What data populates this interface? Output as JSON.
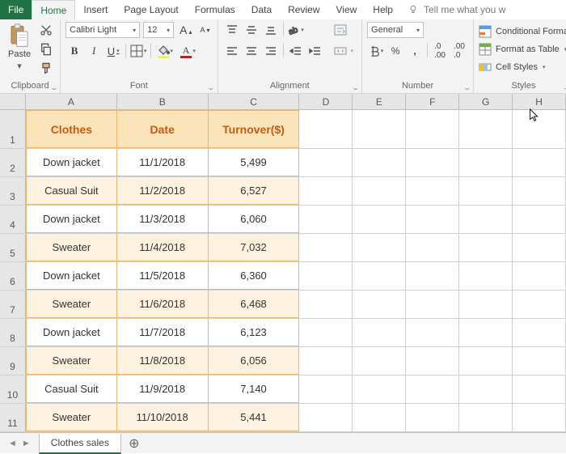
{
  "menu": {
    "file": "File",
    "home": "Home",
    "insert": "Insert",
    "page_layout": "Page Layout",
    "formulas": "Formulas",
    "data": "Data",
    "review": "Review",
    "view": "View",
    "help": "Help",
    "tell_me": "Tell me what you w"
  },
  "ribbon": {
    "clipboard": {
      "label": "Clipboard",
      "paste": "Paste"
    },
    "font": {
      "label": "Font",
      "name": "Calibri Light",
      "size": "12",
      "bold": "B",
      "italic": "I",
      "underline": "U"
    },
    "alignment": {
      "label": "Alignment"
    },
    "number": {
      "label": "Number",
      "format": "General",
      "percent": "%",
      "comma": ","
    },
    "styles": {
      "label": "Styles",
      "conditional": "Conditional Forma",
      "table": "Format as Table",
      "cell": "Cell Styles"
    }
  },
  "columns": [
    "A",
    "B",
    "C",
    "D",
    "E",
    "F",
    "G",
    "H"
  ],
  "table": {
    "headers": [
      "Clothes",
      "Date",
      "Turnover($)"
    ],
    "rows": [
      {
        "n": "2",
        "c": "Down jacket",
        "d": "11/1/2018",
        "t": "5,499",
        "band": false
      },
      {
        "n": "3",
        "c": "Casual Suit",
        "d": "11/2/2018",
        "t": "6,527",
        "band": true
      },
      {
        "n": "4",
        "c": "Down jacket",
        "d": "11/3/2018",
        "t": "6,060",
        "band": false
      },
      {
        "n": "5",
        "c": "Sweater",
        "d": "11/4/2018",
        "t": "7,032",
        "band": true
      },
      {
        "n": "6",
        "c": "Down jacket",
        "d": "11/5/2018",
        "t": "6,360",
        "band": false
      },
      {
        "n": "7",
        "c": "Sweater",
        "d": "11/6/2018",
        "t": "6,468",
        "band": true
      },
      {
        "n": "8",
        "c": "Down jacket",
        "d": "11/7/2018",
        "t": "6,123",
        "band": false
      },
      {
        "n": "9",
        "c": "Sweater",
        "d": "11/8/2018",
        "t": "6,056",
        "band": true
      },
      {
        "n": "10",
        "c": "Casual Suit",
        "d": "11/9/2018",
        "t": "7,140",
        "band": false
      },
      {
        "n": "11",
        "c": "Sweater",
        "d": "11/10/2018",
        "t": "5,441",
        "band": true
      }
    ]
  },
  "sheet_tab": "Clothes sales"
}
